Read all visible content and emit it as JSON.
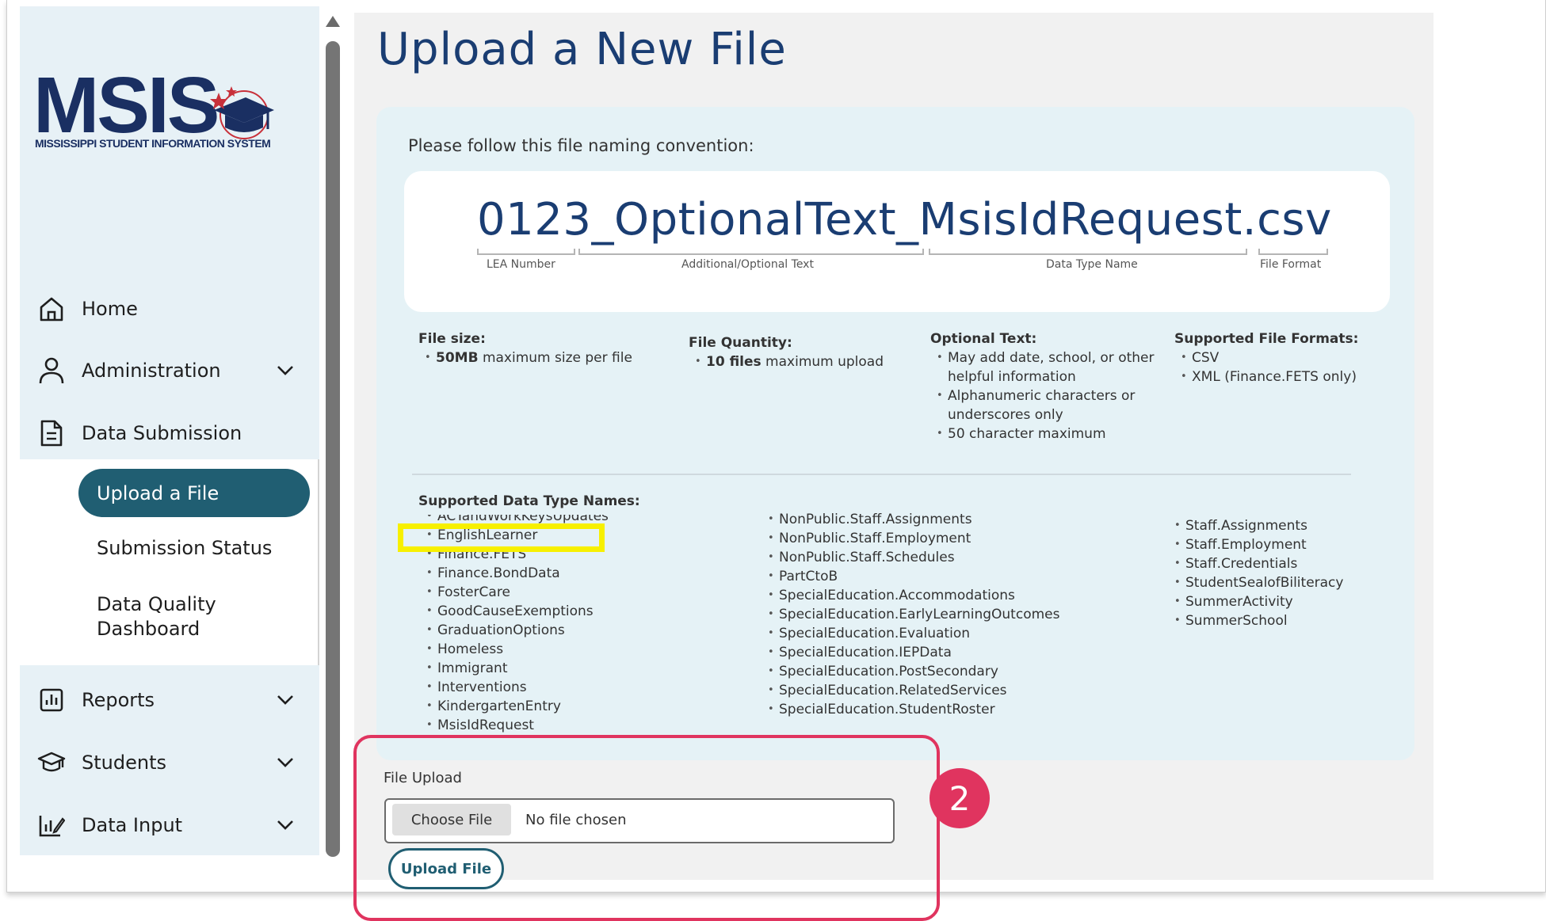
{
  "brand": {
    "logo_text": "MSIS",
    "logo_subtitle": "MISSISSIPPI STUDENT INFORMATION SYSTEM"
  },
  "sidebar": {
    "items": [
      {
        "label": "Home",
        "icon": "home-icon"
      },
      {
        "label": "Administration",
        "icon": "user-icon"
      },
      {
        "label": "Data Submission",
        "icon": "document-icon"
      },
      {
        "label": "Reports",
        "icon": "bar-chart-icon"
      },
      {
        "label": "Students",
        "icon": "graduation-cap-icon"
      },
      {
        "label": "Data Input",
        "icon": "data-input-icon"
      }
    ],
    "sub_items": [
      {
        "label": "Upload a File",
        "active": true
      },
      {
        "label": "Submission Status"
      },
      {
        "label": "Data Quality Dashboard"
      }
    ]
  },
  "page": {
    "title": "Upload a New File",
    "intro": "Please follow this file naming convention:",
    "naming_example": "0123_OptionalText_MsisIdRequest.csv",
    "naming_parts": [
      "LEA Number",
      "Additional/Optional Text",
      "Data Type Name",
      "File Format"
    ]
  },
  "rules": {
    "file_size": {
      "heading": "File size:",
      "items": [
        {
          "bold": "50MB",
          "text": " maximum size per file"
        }
      ]
    },
    "file_quantity": {
      "heading": "File Quantity:",
      "items": [
        {
          "bold": "10 files",
          "text": " maximum upload"
        }
      ]
    },
    "optional_text": {
      "heading": "Optional Text:",
      "items": [
        "May add date, school, or other helpful information",
        "Alphanumeric characters or underscores only",
        "50 character maximum"
      ]
    },
    "formats": {
      "heading": "Supported File Formats:",
      "items": [
        "CSV",
        "XML (Finance.FETS only)"
      ]
    }
  },
  "data_types": {
    "heading": "Supported Data Type Names:",
    "col1": [
      "ACTandWorkKeysUpdates",
      "EnglishLearner",
      "Finance.FETS",
      "Finance.BondData",
      "FosterCare",
      "GoodCauseExemptions",
      "GraduationOptions",
      "Homeless",
      "Immigrant",
      "Interventions",
      "KindergartenEntry",
      "MsisIdRequest"
    ],
    "col2": [
      "NonPublic.Staff.Assignments",
      "NonPublic.Staff.Employment",
      "NonPublic.Staff.Schedules",
      "PartCtoB",
      "SpecialEducation.Accommodations",
      "SpecialEducation.EarlyLearningOutcomes",
      "SpecialEducation.Evaluation",
      "SpecialEducation.IEPData",
      "SpecialEducation.PostSecondary",
      "SpecialEducation.RelatedServices",
      "SpecialEducation.StudentRoster"
    ],
    "col3": [
      "Staff.Assignments",
      "Staff.Employment",
      "Staff.Credentials",
      "StudentSealofBiliteracy",
      "SummerActivity",
      "SummerSchool"
    ]
  },
  "upload": {
    "label": "File Upload",
    "choose_label": "Choose File",
    "no_file": "No file chosen",
    "button": "Upload File"
  },
  "annotation": {
    "step": "2",
    "highlight_color": "#f7f000",
    "callout_color": "#e0345f"
  },
  "colors": {
    "primary": "#205e72",
    "title": "#1a3d72",
    "sidebar_bg": "#e7f1f6"
  }
}
